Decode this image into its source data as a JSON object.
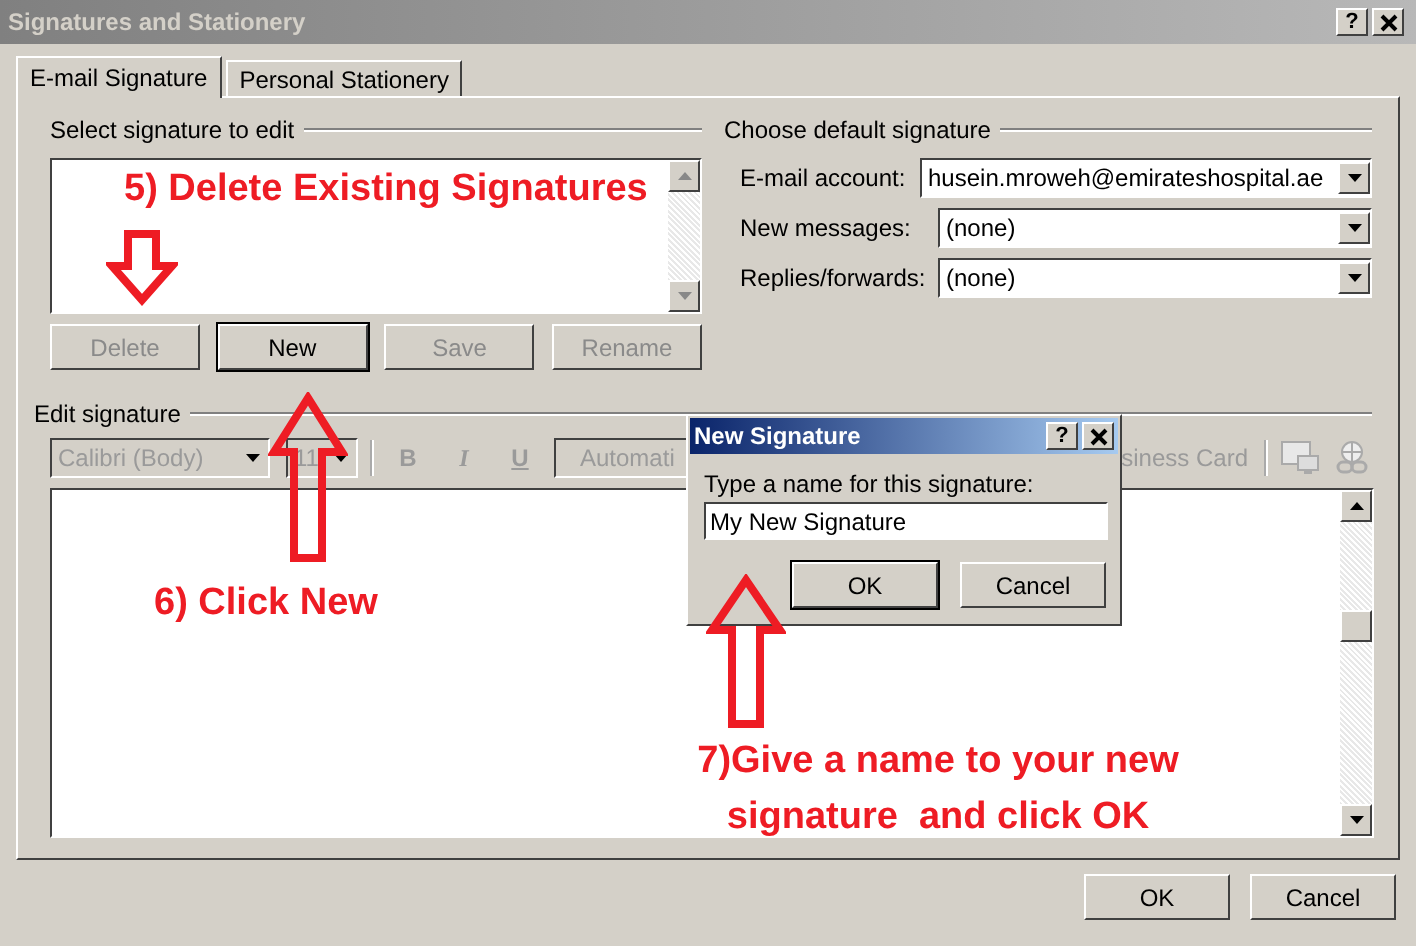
{
  "window": {
    "title": "Signatures and Stationery",
    "help": "?"
  },
  "tabs": [
    {
      "label": "E-mail Signature",
      "selected": true
    },
    {
      "label": "Personal Stationery",
      "selected": false
    }
  ],
  "select_signature": {
    "label": "Select signature to edit",
    "buttons": [
      {
        "label": "Delete",
        "disabled": true,
        "default": false
      },
      {
        "label": "New",
        "disabled": false,
        "default": true
      },
      {
        "label": "Save",
        "disabled": true,
        "default": false
      },
      {
        "label": "Rename",
        "disabled": true,
        "default": false
      }
    ]
  },
  "default_signature": {
    "label": "Choose default signature",
    "fields": [
      {
        "label": "E-mail account:",
        "value": "husein.mroweh@emirateshospital.ae"
      },
      {
        "label": "New messages:",
        "value": "(none)"
      },
      {
        "label": "Replies/forwards:",
        "value": "(none)"
      }
    ]
  },
  "edit_signature": {
    "label": "Edit signature",
    "disabled": true,
    "font": "Calibri (Body)",
    "size": "11",
    "format_buttons": [
      "B",
      "I",
      "U"
    ],
    "color_picker": "Automati",
    "business_card": "siness Card"
  },
  "footer_buttons": [
    "OK",
    "Cancel"
  ],
  "dialog": {
    "title": "New Signature",
    "help": "?",
    "prompt": "Type a name for this signature:",
    "value": "My New Signature",
    "buttons": [
      "OK",
      "Cancel"
    ]
  },
  "annotations": [
    {
      "text": "5) Delete Existing Signatures"
    },
    {
      "text": "6) Click New"
    },
    {
      "text": "7)Give a name to your new signature  and click OK"
    }
  ]
}
